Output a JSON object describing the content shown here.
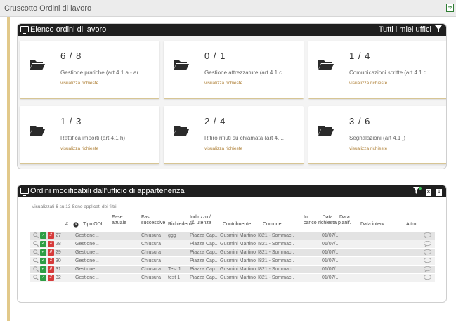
{
  "window": {
    "title": "Cruscotto Ordini di lavoro"
  },
  "panel1": {
    "title": "Elenco ordini di lavoro",
    "filter_label": "Tutti i miei uffici",
    "cards": [
      {
        "fraction": "6 / 8",
        "name": "Gestione pratiche (art 4.1 a - ar...",
        "link": "visualizza richieste"
      },
      {
        "fraction": "0 / 1",
        "name": "Gestione attrezzature (art 4.1 c ...",
        "link": "visualizza richieste"
      },
      {
        "fraction": "1 / 4",
        "name": "Comunicazioni scritte (art 4.1 d...",
        "link": "visualizza richieste"
      },
      {
        "fraction": "1 / 3",
        "name": "Rettifica importi (art 4.1 h)",
        "link": "visualizza richieste"
      },
      {
        "fraction": "2 / 4",
        "name": "Ritiro rifiuti su chiamata (art 4....",
        "link": "visualizza richieste"
      },
      {
        "fraction": "3 / 6",
        "name": "Segnalazioni (art 4.1 j)",
        "link": "visualizza richieste"
      }
    ]
  },
  "panel2": {
    "title": "Ordini modificabili dall'ufficio di appartenenza",
    "summary": "Visualizzati 6 su 13   Sono applicati dei filtri.",
    "columns": {
      "num": "#",
      "tipo": "Tipo ODL",
      "fase_att": "Fase\nattuale",
      "fasi_succ": "Fasi\nsuccessive",
      "rich": "Richiedente",
      "ind": "Indirizzo /\nrif. utenza",
      "contr": "Contribuente",
      "comune": "Comune",
      "incarico": "In\ncarico",
      "data_rich": "Data\nrichiesta",
      "data_pian": "Data\npianif.",
      "data_int": "Data interv.",
      "altro": "Altro"
    },
    "rows": [
      {
        "num": "27",
        "tipo": "Gestione ..",
        "fasi_succ": "Chiusura",
        "rich": "ggg",
        "ind": "Piazza Cap..",
        "contr": "Gusmini Martino",
        "comune": "I821 - Sommac..",
        "data_rich": "01/07/.."
      },
      {
        "num": "28",
        "tipo": "Gestione ..",
        "fasi_succ": "Chiusura",
        "rich": "",
        "ind": "Piazza Cap..",
        "contr": "Gusmini Martino",
        "comune": "I821 - Sommac..",
        "data_rich": "01/07/.."
      },
      {
        "num": "29",
        "tipo": "Gestione ..",
        "fasi_succ": "Chiusura",
        "rich": "",
        "ind": "Piazza Cap..",
        "contr": "Gusmini Martino",
        "comune": "I821 - Sommac..",
        "data_rich": "01/07/.."
      },
      {
        "num": "30",
        "tipo": "Gestione ..",
        "fasi_succ": "Chiusura",
        "rich": "",
        "ind": "Piazza Cap..",
        "contr": "Gusmini Martino",
        "comune": "I821 - Sommac..",
        "data_rich": "01/07/.."
      },
      {
        "num": "31",
        "tipo": "Gestione ..",
        "fasi_succ": "Chiusura",
        "rich": "Test 1",
        "ind": "Piazza Cap..",
        "contr": "Gusmini Martino",
        "comune": "I821 - Sommac..",
        "data_rich": "01/07/.."
      },
      {
        "num": "32",
        "tipo": "Gestione ..",
        "fasi_succ": "Chiusura",
        "rich": "test 1",
        "ind": "Piazza Cap..",
        "contr": "Gusmini Martino",
        "comune": "I821 - Sommac..",
        "data_rich": "01/07/.."
      }
    ]
  },
  "colors": {
    "header": "#1f1f1f",
    "accent": "#d7c594",
    "link": "#b0823a",
    "ok": "#2e9e44",
    "cancel": "#d63b3b"
  },
  "icons": [
    "monitor-icon",
    "filter-icon",
    "folder-icon",
    "excel-export-icon",
    "pdf-export-icon",
    "search-icon",
    "check-icon",
    "close-icon",
    "comment-icon",
    "clock-icon"
  ]
}
